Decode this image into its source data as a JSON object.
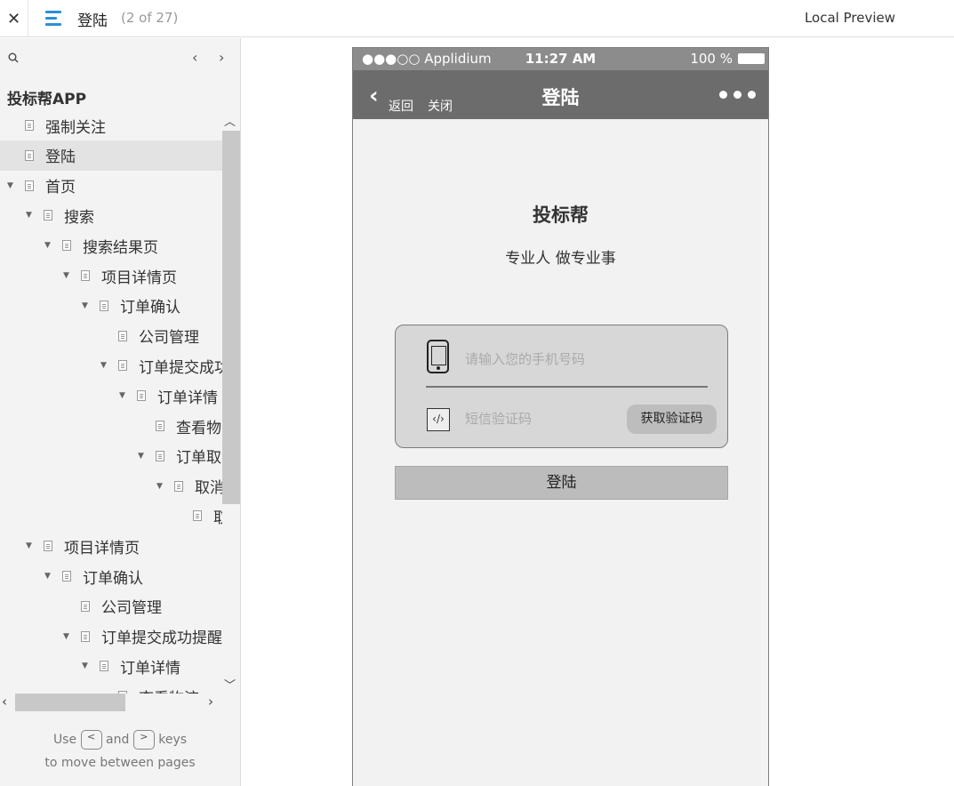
{
  "topbar": {
    "close_glyph": "✕",
    "page_title": "登陆",
    "page_count": "(2 of 27)",
    "preview_label": "Local Preview"
  },
  "sidebar": {
    "prev_glyph": "‹",
    "next_glyph": "›",
    "project_title": "投标帮APP",
    "tree": [
      {
        "label": "强制关注",
        "level": 1,
        "caret": false,
        "selected": false
      },
      {
        "label": "登陆",
        "level": 1,
        "caret": false,
        "selected": true
      },
      {
        "label": "首页",
        "level": 1,
        "caret": true,
        "selected": false
      },
      {
        "label": "搜索",
        "level": 2,
        "caret": true,
        "selected": false
      },
      {
        "label": "搜索结果页",
        "level": 3,
        "caret": true,
        "selected": false
      },
      {
        "label": "项目详情页",
        "level": 4,
        "caret": true,
        "selected": false
      },
      {
        "label": "订单确认",
        "level": 5,
        "caret": true,
        "selected": false
      },
      {
        "label": "公司管理",
        "level": 6,
        "caret": false,
        "selected": false
      },
      {
        "label": "订单提交成功",
        "level": 6,
        "caret": true,
        "selected": false
      },
      {
        "label": "订单详情",
        "level": 7,
        "caret": true,
        "selected": false
      },
      {
        "label": "查看物流",
        "level": 8,
        "caret": false,
        "selected": false
      },
      {
        "label": "订单取消",
        "level": 8,
        "caret": true,
        "selected": false
      },
      {
        "label": "取消",
        "level": 9,
        "caret": true,
        "selected": false
      },
      {
        "label": "取",
        "level": 10,
        "caret": false,
        "selected": false
      },
      {
        "label": "项目详情页",
        "level": 2,
        "caret": true,
        "selected": false
      },
      {
        "label": "订单确认",
        "level": 3,
        "caret": true,
        "selected": false
      },
      {
        "label": "公司管理",
        "level": 4,
        "caret": false,
        "selected": false
      },
      {
        "label": "订单提交成功提醒",
        "level": 4,
        "caret": true,
        "selected": false
      },
      {
        "label": "订单详情",
        "level": 5,
        "caret": true,
        "selected": false
      },
      {
        "label": "查看物流",
        "level": 6,
        "caret": false,
        "selected": false
      }
    ],
    "hint_use": "Use",
    "hint_and": "and",
    "hint_keys": "keys",
    "hint_line2": "to move between pages",
    "key_prev": "<",
    "key_next": ">"
  },
  "phone": {
    "carrier": "●●●○○ Applidium",
    "time": "11:27 AM",
    "battery": "100 %",
    "back_glyph": "‹",
    "back_label": "返回",
    "close_label": "关闭",
    "title": "登陆",
    "brand": "投标帮",
    "slogan": "专业人 做专业事",
    "phone_placeholder": "请输入您的手机号码",
    "code_placeholder": "短信验证码",
    "code_icon_glyph": "‹/›",
    "get_code_label": "获取验证码",
    "login_label": "登陆"
  }
}
